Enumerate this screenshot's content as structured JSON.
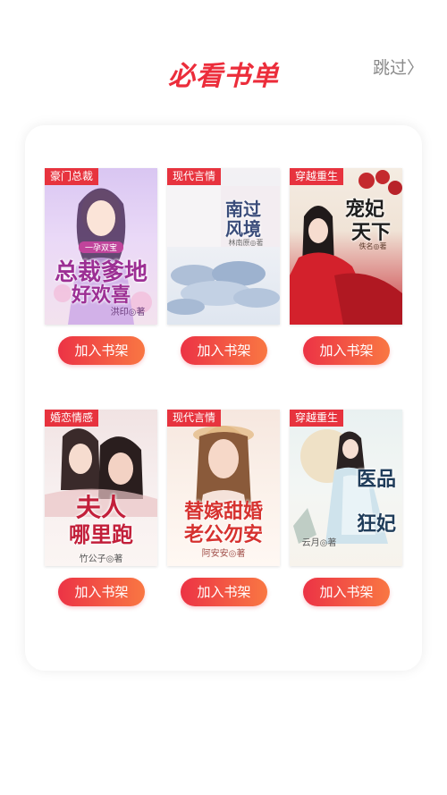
{
  "header": {
    "title": "必看书单",
    "skip_label": "跳过〉"
  },
  "books": [
    {
      "tag": "豪门总裁",
      "title_line1": "总裁爹地",
      "title_line2": "好欢喜",
      "badge": "一孕双宝",
      "author": "洪印◎著",
      "button": "加入书架"
    },
    {
      "tag": "现代言情",
      "title_line1": "南过",
      "title_line2": "风境",
      "badge": "",
      "author": "林南原◎著",
      "button": "加入书架"
    },
    {
      "tag": "穿越重生",
      "title_line1": "宠妃",
      "title_line2": "天下",
      "badge": "",
      "author": "佚名◎著",
      "button": "加入书架"
    },
    {
      "tag": "婚恋情感",
      "title_line1": "夫人",
      "title_line2": "哪里跑",
      "badge": "",
      "author": "竹公子◎著",
      "button": "加入书架"
    },
    {
      "tag": "现代言情",
      "title_line1": "替嫁甜婚",
      "title_line2": "老公勿安",
      "badge": "",
      "author": "阿安安◎著",
      "button": "加入书架"
    },
    {
      "tag": "穿越重生",
      "title_line1": "医品",
      "title_line2": "狂妃",
      "badge": "",
      "author": "云月◎著",
      "button": "加入书架"
    }
  ],
  "colors": {
    "accent": "#ec2d3b",
    "button_start": "#ec3345",
    "button_end": "#f97743",
    "tag_bg": "#e7333e"
  }
}
